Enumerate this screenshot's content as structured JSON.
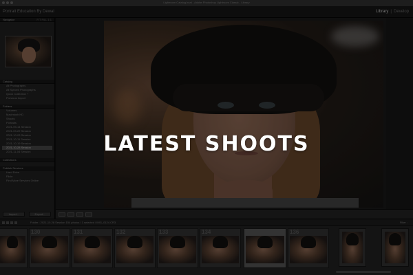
{
  "window": {
    "title": "Lightroom Catalog.lrcat - Adobe Photoshop Lightroom Classic - Library"
  },
  "identity_plate": "Portrait Education By Dewal",
  "modules": {
    "items": [
      "Library",
      "|",
      "Develop"
    ],
    "active": "Library"
  },
  "left_panel": {
    "navigator_label": "Navigator",
    "navigator_controls": "FIT  FILL  1:1",
    "catalog_label": "Catalog",
    "catalog_items": [
      {
        "label": "All Photographs",
        "count": ""
      },
      {
        "label": "All Synced Photographs",
        "count": ""
      },
      {
        "label": "Quick Collection +",
        "count": ""
      },
      {
        "label": "Previous Import",
        "count": ""
      }
    ],
    "folders_label": "Folders",
    "folder_items": [
      {
        "label": "Volumes",
        "count": ""
      },
      {
        "label": "Macintosh HD",
        "count": ""
      },
      {
        "label": "Shoots",
        "count": ""
      },
      {
        "label": "Portraits",
        "count": ""
      },
      {
        "label": "2021-09-14 Session",
        "count": ""
      },
      {
        "label": "2021-09-22 Session",
        "count": ""
      },
      {
        "label": "2021-10-03 Session",
        "count": ""
      },
      {
        "label": "2021-10-11 Session",
        "count": ""
      },
      {
        "label": "2021-10-19 Session",
        "count": ""
      },
      {
        "label": "2021-10-28 Session",
        "count": ""
      },
      {
        "label": "2021-11-04 Session",
        "count": ""
      }
    ],
    "collections_label": "Collections",
    "publish_label": "Publish Services",
    "publish_items": [
      {
        "label": "Hard Drive",
        "count": ""
      },
      {
        "label": "Flickr",
        "count": ""
      },
      {
        "label": "Find More Services Online",
        "count": ""
      }
    ],
    "import_button": "Import...",
    "export_button": "Export..."
  },
  "toolbar": {
    "view_modes": [
      "grid",
      "loupe",
      "compare",
      "survey"
    ]
  },
  "filmstrip_bar": {
    "source_text": "Folder : 2021-10-28 Session   154 photos / 1 selected / IMG_0124.CR3",
    "filter_text": "Filter :"
  },
  "filmstrip": {
    "numbers": [
      "130",
      "131",
      "132",
      "133",
      "134",
      "135",
      "136",
      "137"
    ]
  },
  "headline": "LATEST SHOOTS"
}
